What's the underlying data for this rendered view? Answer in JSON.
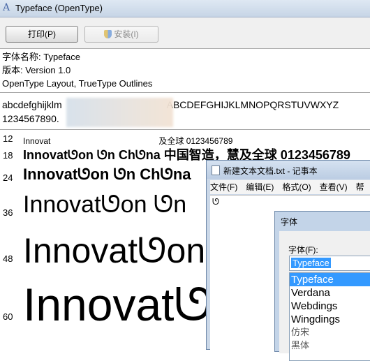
{
  "window": {
    "title": "Typeface (OpenType)"
  },
  "toolbar": {
    "print_label": "打印(P)",
    "install_label": "安装(I)"
  },
  "info": {
    "font_name": "字体名称: Typeface",
    "version": "版本: Version 1.0",
    "type": "OpenType Layout, TrueType Outlines"
  },
  "charset": {
    "line1_left": "abcdefghijklm",
    "line1_right": "ABCDEFGHIJKLMNOPQRSTUVWXYZ",
    "line2": "1234567890."
  },
  "samples": [
    {
      "size": "12",
      "text": "Innovat",
      "tail": "及全球 0123456789"
    },
    {
      "size": "18",
      "text": "Innovatᘎon ᘎn Chᘎna 中国智造，慧及全球 0123456789"
    },
    {
      "size": "24",
      "text": "Innovatᘎon ᘎn Chᘎna"
    },
    {
      "size": "36",
      "text": "Innovatᘎon ᘎn"
    },
    {
      "size": "48",
      "text": "Innovatᘎon"
    },
    {
      "size": "60",
      "text": "Innovatᘎ"
    }
  ],
  "notepad": {
    "title": "新建文本文档.txt - 记事本",
    "menu": [
      "文件(F)",
      "编辑(E)",
      "格式(O)",
      "查看(V)",
      "帮"
    ],
    "content": "ᘎ"
  },
  "font_dialog": {
    "title": "字体",
    "font_label": "字体(F):",
    "font_value": "Typeface",
    "fonts": [
      "Typeface",
      "Verdana",
      "Webdings",
      "Wingdings",
      "仿宋",
      "黑体"
    ],
    "selected_index": 0
  },
  "colors": {
    "selection": "#3399ff",
    "titlebar": "#c7d5e6"
  },
  "icons": {
    "app": "font-a-icon",
    "install": "shield-icon",
    "notepad": "notepad-icon"
  }
}
